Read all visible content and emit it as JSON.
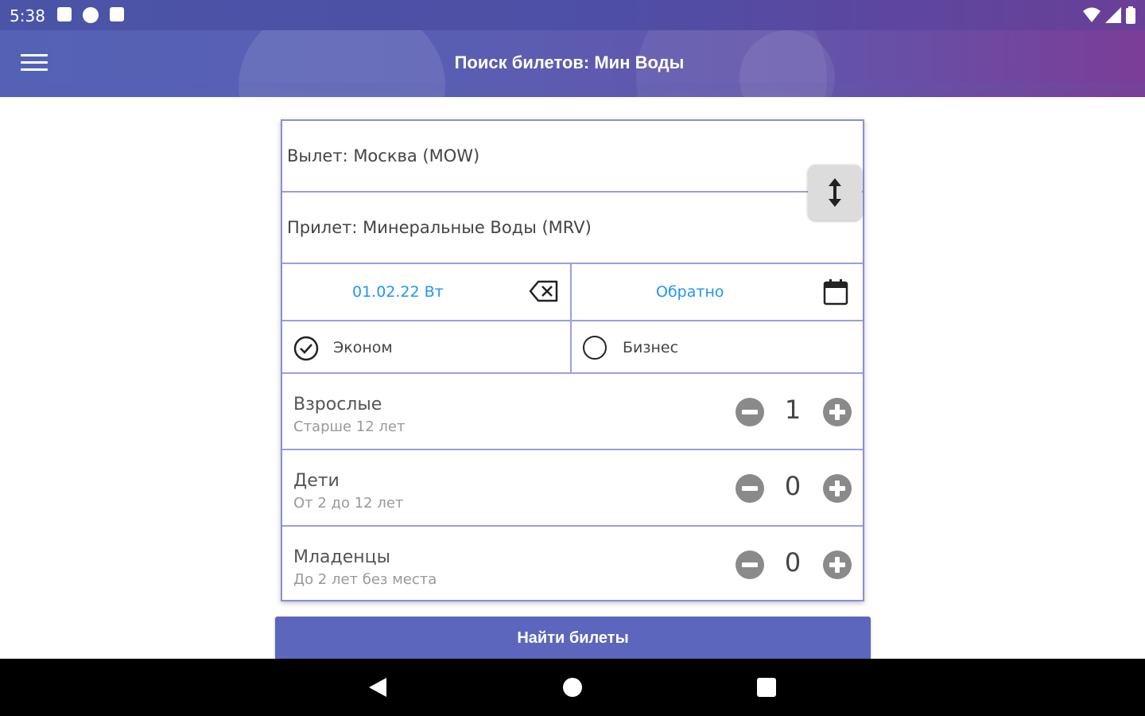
{
  "status_bar": {
    "time": "5:38",
    "left_icons": [
      "notification-a-icon",
      "notification-p-icon",
      "sd-card-icon"
    ],
    "right_icons": [
      "wifi-icon",
      "signal-icon",
      "battery-icon"
    ]
  },
  "app_bar": {
    "title": "Поиск билетов: Мин Воды",
    "menu_icon": "hamburger-menu-icon",
    "gradient_colors": [
      "#5462b5",
      "#7b3d97"
    ]
  },
  "form": {
    "departure": "Вылет: Москва (MOW)",
    "arrival": "Прилет: Минеральные Воды (MRV)",
    "swap_icon": "swap-vertical-icon",
    "depart_date": "01.02.22 Вт",
    "clear_date_icon": "backspace-icon",
    "return_date": "Обратно",
    "calendar_icon": "calendar-icon",
    "classes": [
      {
        "label": "Эконом",
        "selected": true
      },
      {
        "label": "Бизнес",
        "selected": false
      }
    ],
    "passengers": [
      {
        "title": "Взрослые",
        "subtitle": "Старше 12 лет",
        "count": "1"
      },
      {
        "title": "Дети",
        "subtitle": "От 2 до 12 лет",
        "count": "0"
      },
      {
        "title": "Младенцы",
        "subtitle": "До 2 лет без места",
        "count": "0"
      }
    ]
  },
  "search_button": {
    "label": "Найти билеты",
    "color": "#5c66bc"
  },
  "nav_bar": {
    "icons": [
      "back-icon",
      "home-icon",
      "recents-icon"
    ]
  },
  "colors": {
    "accent_blue": "#2196f3",
    "divider": "#9aa0dc"
  }
}
